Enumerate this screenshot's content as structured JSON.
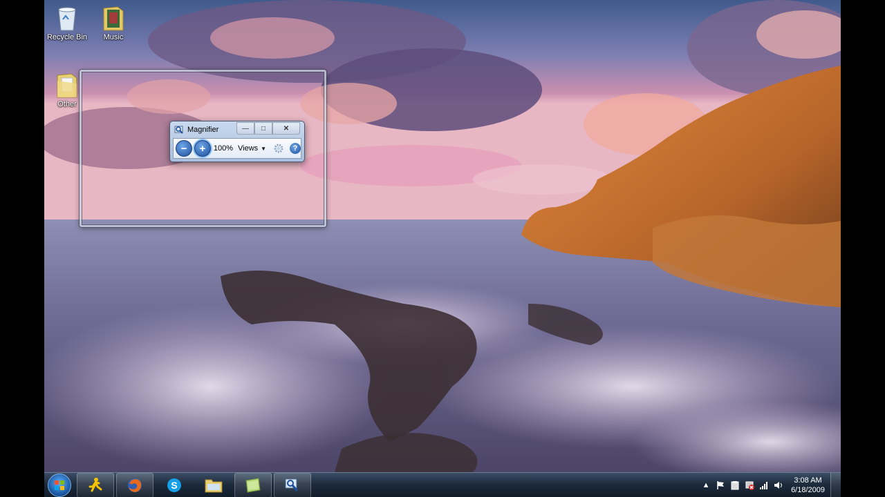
{
  "desktop": {
    "icons": [
      {
        "label": "Recycle Bin",
        "icon": "recycle-bin-icon"
      },
      {
        "label": "Music",
        "icon": "music-folder-icon"
      },
      {
        "label": "Other",
        "icon": "folder-icon"
      }
    ]
  },
  "magnifier": {
    "title": "Magnifier",
    "zoom_out_symbol": "−",
    "zoom_in_symbol": "+",
    "zoom_level": "100%",
    "views_label": "Views",
    "help_symbol": "?",
    "caption": {
      "minimize": "—",
      "maximize": "□",
      "close": "✕"
    }
  },
  "taskbar": {
    "apps": [
      {
        "name": "AIM",
        "icon": "aim-running-man-icon"
      },
      {
        "name": "Firefox",
        "icon": "firefox-icon"
      },
      {
        "name": "Skype",
        "icon": "skype-icon"
      },
      {
        "name": "Windows Explorer",
        "icon": "explorer-folder-icon"
      },
      {
        "name": "Sticky Notes",
        "icon": "sticky-notes-icon"
      },
      {
        "name": "Magnifier",
        "icon": "magnifier-icon"
      }
    ],
    "clock": {
      "time": "3:08 AM",
      "date": "6/18/2009"
    }
  },
  "colors": {
    "taskbar": "#1d2b3c",
    "accent_blue": "#1c4f9c"
  }
}
